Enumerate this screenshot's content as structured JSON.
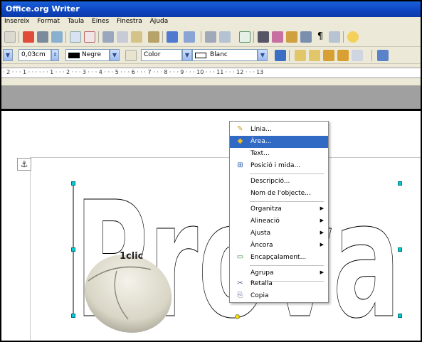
{
  "window": {
    "title": "Office.org Writer"
  },
  "menubar": [
    "Insereix",
    "Format",
    "Taula",
    "Eines",
    "Finestra",
    "Ajuda"
  ],
  "toolbar": {
    "line_width": "0,03cm",
    "line_color": "Negre",
    "area_style": "Color",
    "area_color": "Blanc"
  },
  "ruler": {
    "ticks": "· 2 · · · 1 · · ·   · · · 1 · · · 2 · · · 3 · · · 4 · · · 5 · · · 6 · · · 7 · · · 8 · · · 9 · · · 10 · · · 11 · · · 12 · · · 13"
  },
  "drawing": {
    "word": "Prova",
    "mouse_label": "1clic"
  },
  "context_menu": {
    "items": [
      {
        "label": "Línia...",
        "icon": "line-icon"
      },
      {
        "label": "Àrea...",
        "icon": "area-fill-icon",
        "highlighted": true
      },
      {
        "label": "Text...",
        "icon": ""
      },
      {
        "label": "Posició i mida...",
        "icon": "position-size-icon"
      },
      {
        "label": "Descripció...",
        "icon": ""
      },
      {
        "label": "Nom de l'objecte...",
        "icon": ""
      },
      {
        "label": "Organitza",
        "icon": "",
        "submenu": true
      },
      {
        "label": "Alineació",
        "icon": "",
        "submenu": true
      },
      {
        "label": "Ajusta",
        "icon": "",
        "submenu": true
      },
      {
        "label": "Àncora",
        "icon": "",
        "submenu": true
      },
      {
        "label": "Encapçalament...",
        "icon": "caption-icon"
      },
      {
        "label": "Agrupa",
        "icon": "",
        "submenu": true
      },
      {
        "label": "Retalla",
        "icon": "cut-icon"
      },
      {
        "label": "Copia",
        "icon": "copy-icon"
      }
    ]
  },
  "colors": {
    "titlebar": "#0d46c2",
    "toolbar_bg": "#ece9d8",
    "highlight": "#316ac5",
    "handle": "#00c9d6"
  }
}
